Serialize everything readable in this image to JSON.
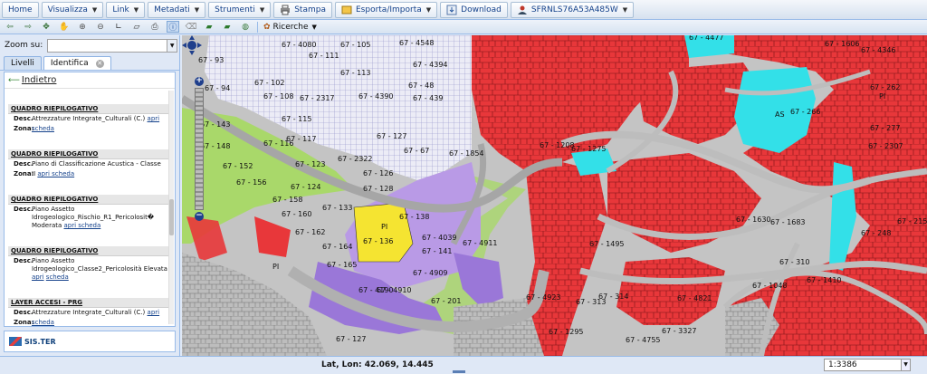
{
  "menubar": {
    "items": [
      {
        "label": "Home",
        "dropdown": false
      },
      {
        "label": "Visualizza",
        "dropdown": true
      },
      {
        "label": "Link",
        "dropdown": true
      },
      {
        "label": "Metadati",
        "dropdown": true
      },
      {
        "label": "Strumenti",
        "dropdown": true
      },
      {
        "label": "Stampa",
        "dropdown": false,
        "icon": "printer-icon"
      },
      {
        "label": "Esporta/Importa",
        "dropdown": true,
        "icon": "export-icon"
      },
      {
        "label": "Download",
        "dropdown": false,
        "icon": "download-icon"
      },
      {
        "label": "SFRNLS76A53A485W",
        "dropdown": true,
        "icon": "user-icon"
      }
    ]
  },
  "toolbar": {
    "ricerche_label": "Ricerche",
    "tools": [
      "back-arrow-icon",
      "forward-arrow-icon",
      "zoom-extent-icon",
      "pan-icon",
      "zoom-in-icon",
      "zoom-out-icon",
      "measure-line-icon",
      "measure-area-icon",
      "print-icon",
      "info-icon",
      "eraser-icon",
      "car-icon",
      "car-alt-icon",
      "globe-icon"
    ],
    "active_tool": "info-icon"
  },
  "left": {
    "zoom_label": "Zoom su:",
    "zoom_value": "",
    "tabs": [
      {
        "label": "Livelli",
        "active": false
      },
      {
        "label": "Identifica",
        "active": true,
        "closable": true
      }
    ],
    "back_label": "Indietro",
    "sections": [
      {
        "title": "QUADRO RIEPILOGATIVO",
        "desc": "Attrezzature Integrate_Culturali (C.)",
        "desc_link": "apri",
        "zona_text": "",
        "zona_link": "scheda"
      },
      {
        "title": "QUADRO RIEPILOGATIVO",
        "desc": "Piano di Classificazione Acustica - Classe",
        "desc_link": "",
        "zona_text": "II",
        "zona_link": "apri scheda"
      },
      {
        "title": "QUADRO RIEPILOGATIVO",
        "desc": "Piano Assetto Idrogeologico_Rischio_R1_Pericolosit� Moderata",
        "desc_link": "apri scheda",
        "zona_text": "",
        "zona_link": ""
      },
      {
        "title": "QUADRO RIEPILOGATIVO",
        "desc": "Piano Assetto Idrogeologico_Classe2_Pericolosità Elevata",
        "desc_link": "apri",
        "zona_text": "",
        "zona_link": "scheda"
      },
      {
        "title": "LAYER ACCESI - PRG",
        "desc": "Attrezzature Integrate_Culturali (C.)",
        "desc_link": "apri",
        "zona_text": "",
        "zona_link": "scheda"
      }
    ],
    "row_keys": {
      "desc": "Desc.",
      "zona": "Zona:"
    },
    "logo_text": "SIS.TER"
  },
  "status": {
    "latlon": "Lat, Lon: 42.069, 14.445",
    "scale": "1:3386"
  },
  "map_labels": [
    "67 - 4080",
    "67 - 105",
    "67 - 4548",
    "67 - 93",
    "67 - 111",
    "67 - 4394",
    "67 - 113",
    "67 - 102",
    "67 - 94",
    "67 - 108",
    "67 - 2317",
    "67 - 4390",
    "67 - 48",
    "67 - 439",
    "67 - 143",
    "67 - 115",
    "67 - 117",
    "67 - 127",
    "67 - 148",
    "67 - 116",
    "67 - 67",
    "67 - 2322",
    "67 - 152",
    "67 - 123",
    "67 - 126",
    "67 - 1854",
    "67 - 156",
    "67 - 124",
    "67 - 128",
    "67 - 158",
    "67 - 133",
    "67 - 160",
    "67 - 138",
    "67 - 162",
    "67 - 136",
    "67 - 4039",
    "67 - 164",
    "67 - 141",
    "67 - 4911",
    "67 - 165",
    "67 - 4909",
    "67 - 4910",
    "67 - 4190",
    "67 - 201",
    "67 - 1495",
    "67 - 313",
    "67 - 314",
    "67 - 4923",
    "67 - 4755",
    "67 - 1295",
    "67 - 4821",
    "67 - 310",
    "67 - 3327",
    "67 - 1606",
    "67 - 4477",
    "67 - 4346",
    "67 - 262",
    "67 - 266",
    "67 - 277",
    "67 - 2307",
    "67 - 2151",
    "67 - 248",
    "67 - 1683",
    "67 - 1048",
    "67 - 1630",
    "67 - 1410",
    "67 - 1208",
    "67 - 1275",
    "67 - 127"
  ],
  "map_zone_labels": [
    "PI",
    "PI",
    "PI",
    "AS"
  ],
  "colors": {
    "red_zone": "#e8373a",
    "purple_zone": "#b99ae6",
    "yellow_zone": "#f5e431",
    "green_zone": "#a9d86a",
    "cyan_zone": "#33e0e8",
    "grid_zone": "#e6e6f2",
    "road": "#bdbdbd"
  }
}
